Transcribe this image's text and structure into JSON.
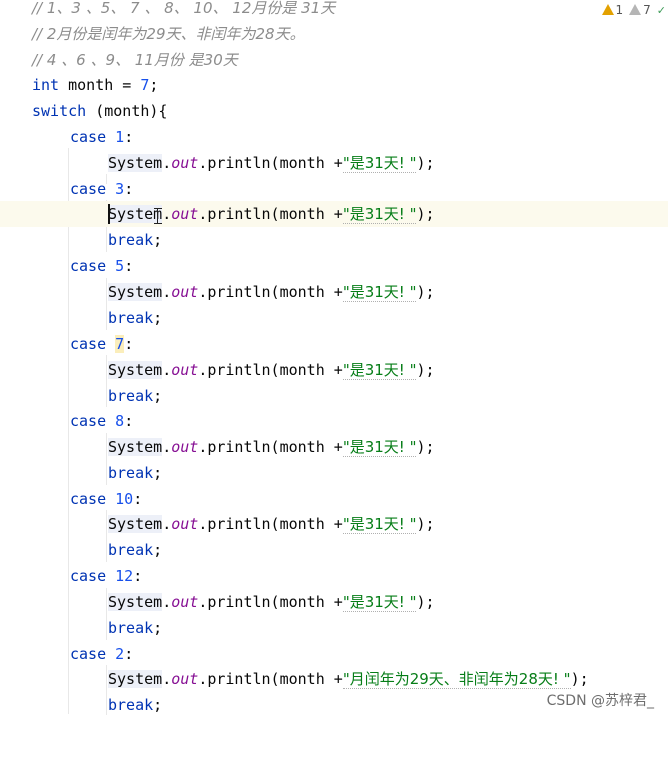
{
  "inspections": {
    "warnings": "1",
    "weak_warnings": "7",
    "ok_icon": "check-icon"
  },
  "comments": [
    "// 1、3 、5、 7 、 8、 10、 12月份是 31天",
    "// 2月份是闰年为29天、非闰年为28天。",
    "// 4 、6 、9、 11月份 是30天"
  ],
  "code": {
    "kw_int": "int",
    "var_decl": " month = ",
    "month_value": "7",
    "semicolon": ";",
    "kw_switch": "switch",
    "switch_expr": " (month){",
    "kw_case": "case",
    "kw_break": "break",
    "system": "System",
    "dot": ".",
    "out": "out",
    "println": ".println(month +",
    "str_31": "\"是31天! \"",
    "str_29": "\"月闰年为29天、非闰年为28天! \"",
    "close_call": ");",
    "colon": ":"
  },
  "cases": [
    "1",
    "3",
    "5",
    "7",
    "8",
    "10",
    "12",
    "2"
  ],
  "watermark": "CSDN @苏梓君_"
}
